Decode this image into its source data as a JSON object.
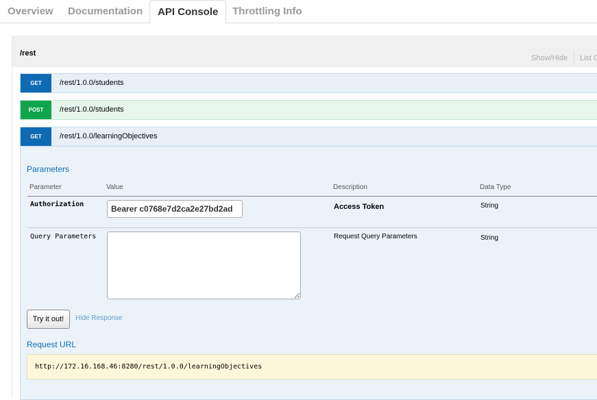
{
  "tabs": [
    {
      "label": "Overview",
      "active": false
    },
    {
      "label": "Documentation",
      "active": false
    },
    {
      "label": "API Console",
      "active": true
    },
    {
      "label": "Throttling Info",
      "active": false
    }
  ],
  "resource": {
    "title": "/rest",
    "show_hide": "Show/Hide",
    "list_ops": "List O"
  },
  "operations": [
    {
      "method": "GET",
      "path": "/rest/1.0.0/students"
    },
    {
      "method": "POST",
      "path": "/rest/1.0.0/students"
    },
    {
      "method": "GET",
      "path": "/rest/1.0.0/learningObjectives"
    }
  ],
  "parameters": {
    "title": "Parameters",
    "headers": {
      "parameter": "Parameter",
      "value": "Value",
      "description": "Description",
      "data_type": "Data Type"
    },
    "rows": [
      {
        "name": "Authorization",
        "value": "Bearer c0768e7d2ca2e27bd2ad",
        "description": "Access Token",
        "type": "String"
      },
      {
        "name": "Query Parameters",
        "value": "",
        "description": "Request Query Parameters",
        "type": "String"
      }
    ]
  },
  "actions": {
    "try_label": "Try it out!",
    "hide_response": "Hide Response"
  },
  "request_url": {
    "title": "Request URL",
    "value": "http://172.16.168.46:8280/rest/1.0.0/learningObjectives"
  },
  "colors": {
    "get": "#0f6ab4",
    "post": "#10a54a",
    "link": "#0f6ab4"
  }
}
